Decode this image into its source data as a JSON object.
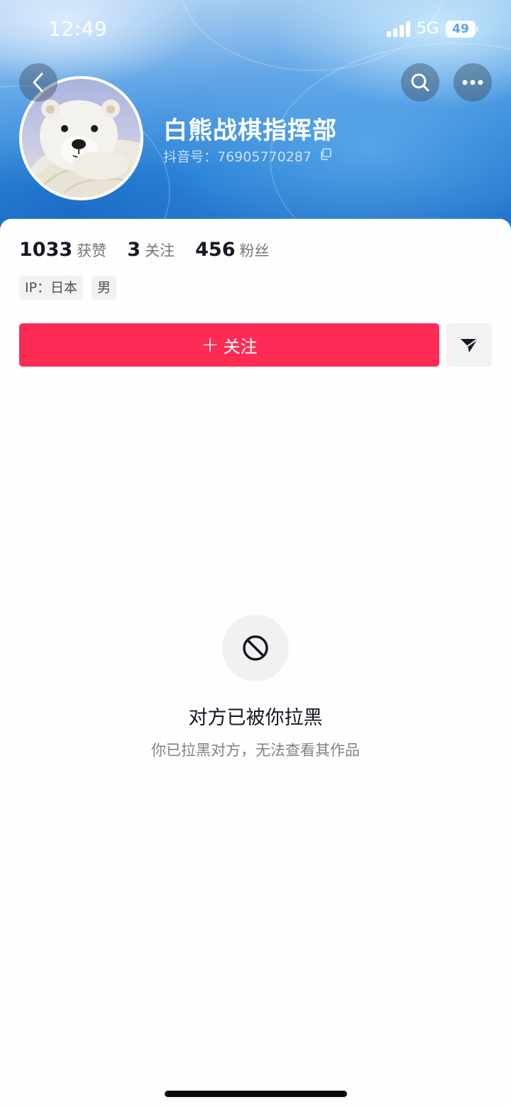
{
  "status_bar": {
    "time": "12:49",
    "network": "5G",
    "battery": "49"
  },
  "header": {
    "back_icon": "chevron-left-icon",
    "search_icon": "search-icon",
    "more_icon": "more-horizontal-icon",
    "background_colors": [
      "#b9d6f3",
      "#2a83d6",
      "#1f6fc7"
    ]
  },
  "profile": {
    "name": "白熊战棋指挥部",
    "douyin_id": "抖音号：76905770287",
    "avatar": "polar-bear-cub-avatar",
    "copy_icon": "copy-icon"
  },
  "stats": [
    {
      "value": "1033",
      "label": "获赞"
    },
    {
      "value": "3",
      "label": "关注"
    },
    {
      "value": "456",
      "label": "粉丝"
    }
  ],
  "tags": {
    "ip": "IP：日本",
    "gender": "男"
  },
  "actions": {
    "follow_plus": "+",
    "follow_label": "关注",
    "share_icon": "send-icon",
    "accent_color": "#fe2c55"
  },
  "blocked": {
    "icon": "block-icon",
    "title": "对方已被你拉黑",
    "subtitle": "你已拉黑对方，无法查看其作品"
  }
}
